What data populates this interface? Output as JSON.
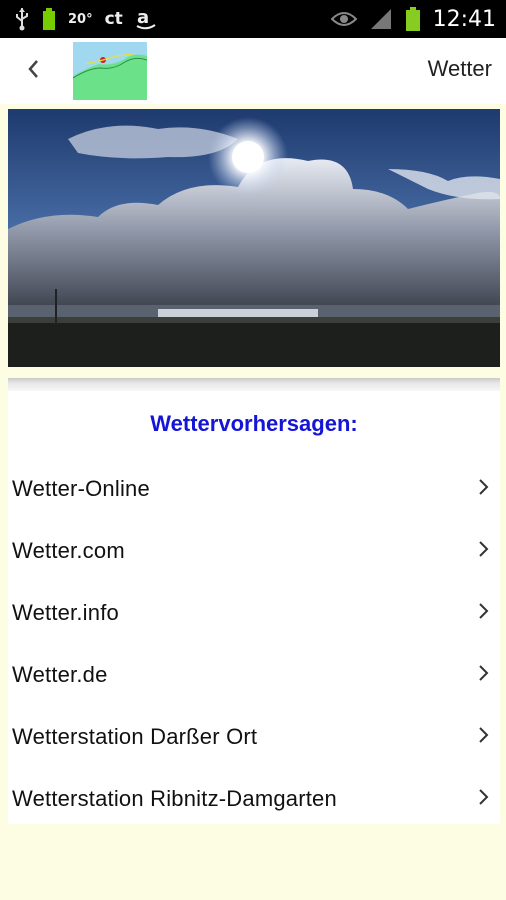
{
  "status_bar": {
    "temperature": "20°",
    "carrier_label": "ct",
    "time": "12:41",
    "icons": [
      "usb-icon",
      "battery-small-icon",
      "ct-icon",
      "amazon-icon",
      "eye-icon",
      "signal-icon",
      "battery-icon"
    ]
  },
  "header": {
    "back_icon": "chevron-left-icon",
    "title": "Wetter"
  },
  "panel": {
    "heading": "Wettervorhersagen:",
    "items": [
      {
        "label": "Wetter-Online"
      },
      {
        "label": "Wetter.com"
      },
      {
        "label": "Wetter.info"
      },
      {
        "label": "Wetter.de"
      },
      {
        "label": "Wetterstation Darßer Ort"
      },
      {
        "label": "Wetterstation Ribnitz-Damgarten"
      }
    ]
  },
  "colors": {
    "background": "#fdfde4",
    "heading": "#1515d6",
    "status_bar": "#000000"
  }
}
